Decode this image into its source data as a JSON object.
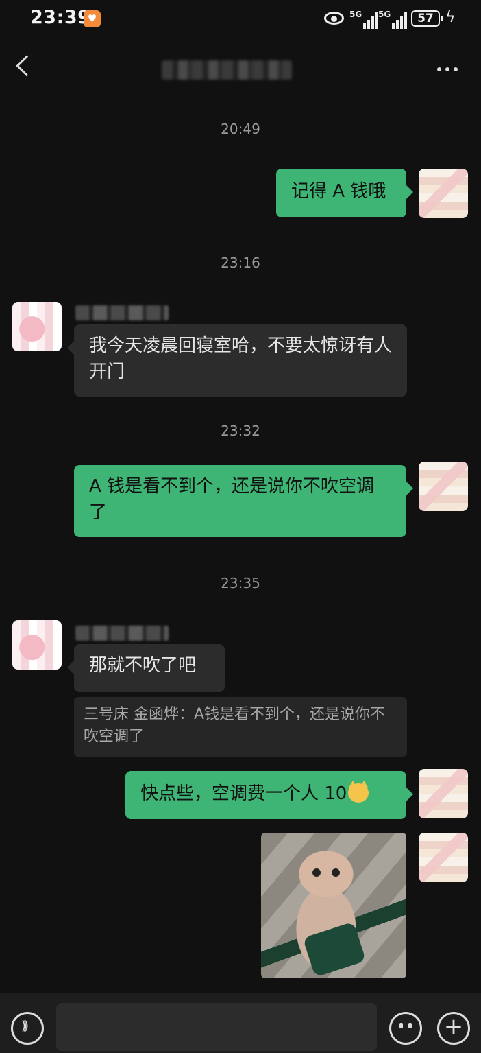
{
  "status_bar": {
    "time": "23:39",
    "network_1": "5G",
    "network_2": "5G",
    "battery": "57"
  },
  "header": {
    "back_icon": "chevron-left-icon",
    "more_icon": "more-icon"
  },
  "timestamps": [
    "20:49",
    "23:16",
    "23:32",
    "23:35"
  ],
  "messages": [
    {
      "from": "me",
      "text": "记得 A 钱哦"
    },
    {
      "from": "them",
      "text": "我今天凌晨回寝室哈，不要太惊讶有人开门"
    },
    {
      "from": "me",
      "text": "A 钱是看不到个，还是说你不吹空调了"
    },
    {
      "from": "them",
      "text": "那就不吹了吧",
      "quote": "三号床 金函烨：A钱是看不到个，还是说你不吹空调了"
    },
    {
      "from": "me",
      "text": "快点些，空调费一个人 10",
      "emoji": "cat-face-icon"
    },
    {
      "from": "me",
      "type": "image",
      "image_icon": "monkey-photo"
    }
  ],
  "toolbar": {
    "voice_icon": "voice-icon",
    "emoji_icon": "emoji-icon",
    "plus_icon": "plus-icon"
  },
  "colors": {
    "background": "#111111",
    "my_bubble": "#3eb575",
    "their_bubble": "#2c2c2c"
  }
}
